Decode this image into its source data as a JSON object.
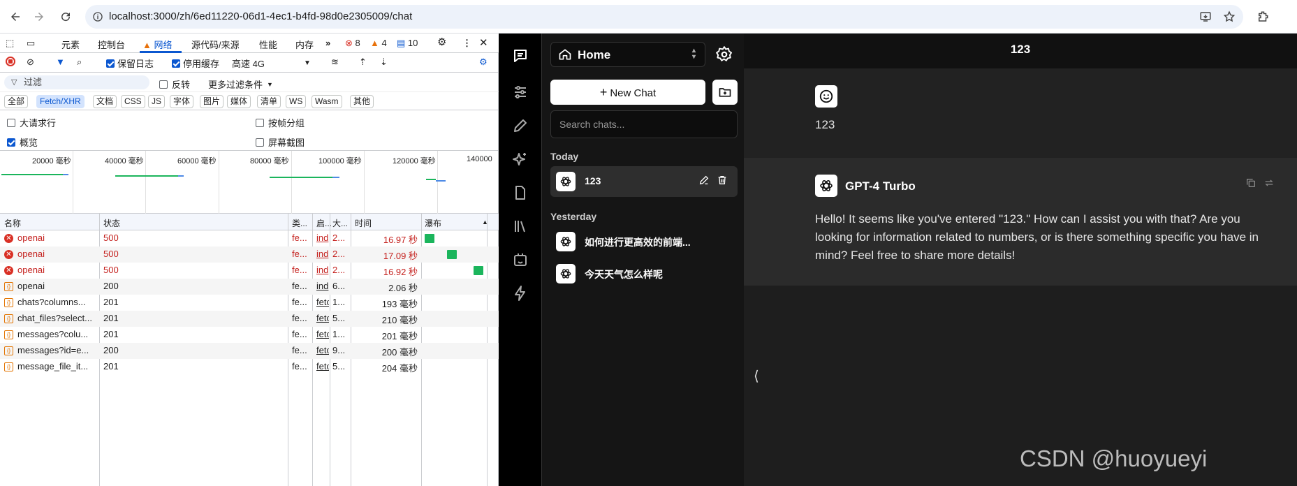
{
  "browser": {
    "url": "localhost:3000/zh/6ed11220-06d1-4ec1-b4fd-98d0e2305009/chat"
  },
  "devtools": {
    "tabs": [
      "元素",
      "控制台",
      "网络",
      "源代码/来源",
      "性能",
      "内存"
    ],
    "active_tab": "网络",
    "errors": "8",
    "warnings": "4",
    "messages": "10",
    "toolbar": {
      "preserve_log": "保留日志",
      "disable_cache": "停用缓存",
      "throttle": "高速 4G"
    },
    "filter": {
      "placeholder": "过滤",
      "invert": "反转",
      "more": "更多过滤条件"
    },
    "types": [
      "全部",
      "Fetch/XHR",
      "文档",
      "CSS",
      "JS",
      "字体",
      "图片",
      "媒体",
      "清单",
      "WS",
      "Wasm",
      "其他"
    ],
    "selected_type": "Fetch/XHR",
    "options": {
      "big_rows": "大请求行",
      "group_by_frame": "按帧分组",
      "overview": "概览",
      "screenshots": "屏幕截图"
    },
    "overview_ticks": [
      "20000 毫秒",
      "40000 毫秒",
      "60000 毫秒",
      "80000 毫秒",
      "100000 毫秒",
      "120000 毫秒",
      "140000"
    ],
    "columns": [
      "名称",
      "状态",
      "类...",
      "启...",
      "大...",
      "时间",
      "瀑布"
    ],
    "rows": [
      {
        "name": "openai",
        "status": "500",
        "type": "fe...",
        "initiator": "ind",
        "size": "2...",
        "time": "16.97 秒",
        "error": true
      },
      {
        "name": "openai",
        "status": "500",
        "type": "fe...",
        "initiator": "ind",
        "size": "2...",
        "time": "17.09 秒",
        "error": true
      },
      {
        "name": "openai",
        "status": "500",
        "type": "fe...",
        "initiator": "ind",
        "size": "2...",
        "time": "16.92 秒",
        "error": true
      },
      {
        "name": "openai",
        "status": "200",
        "type": "fe...",
        "initiator": "ind",
        "size": "6...",
        "time": "2.06 秒",
        "error": false
      },
      {
        "name": "chats?columns...",
        "status": "201",
        "type": "fe...",
        "initiator": "fetc",
        "size": "1...",
        "time": "193 毫秒",
        "error": false
      },
      {
        "name": "chat_files?select...",
        "status": "201",
        "type": "fe...",
        "initiator": "fetc",
        "size": "5...",
        "time": "210 毫秒",
        "error": false
      },
      {
        "name": "messages?colu...",
        "status": "201",
        "type": "fe...",
        "initiator": "fetc",
        "size": "1...",
        "time": "201 毫秒",
        "error": false
      },
      {
        "name": "messages?id=e...",
        "status": "200",
        "type": "fe...",
        "initiator": "fetc",
        "size": "9...",
        "time": "200 毫秒",
        "error": false
      },
      {
        "name": "message_file_it...",
        "status": "201",
        "type": "fe...",
        "initiator": "fetc",
        "size": "5...",
        "time": "204 毫秒",
        "error": false
      }
    ]
  },
  "app": {
    "workspace": "Home",
    "new_chat": "New Chat",
    "search_placeholder": "Search chats...",
    "today_label": "Today",
    "yesterday_label": "Yesterday",
    "today_chats": [
      {
        "title": "123"
      }
    ],
    "yesterday_chats": [
      {
        "title": "如何进行更高效的前端..."
      },
      {
        "title": "今天天气怎么样呢"
      }
    ],
    "chat_title": "123",
    "user_message": "123",
    "bot_name": "GPT-4 Turbo",
    "bot_message": "Hello! It seems like you've entered \"123.\" How can I assist you with that? Are you looking for information related to numbers, or is there something specific you have in mind? Feel free to share more details!",
    "collapse_glyph": "⟨"
  },
  "watermark": "CSDN @huoyueyi"
}
